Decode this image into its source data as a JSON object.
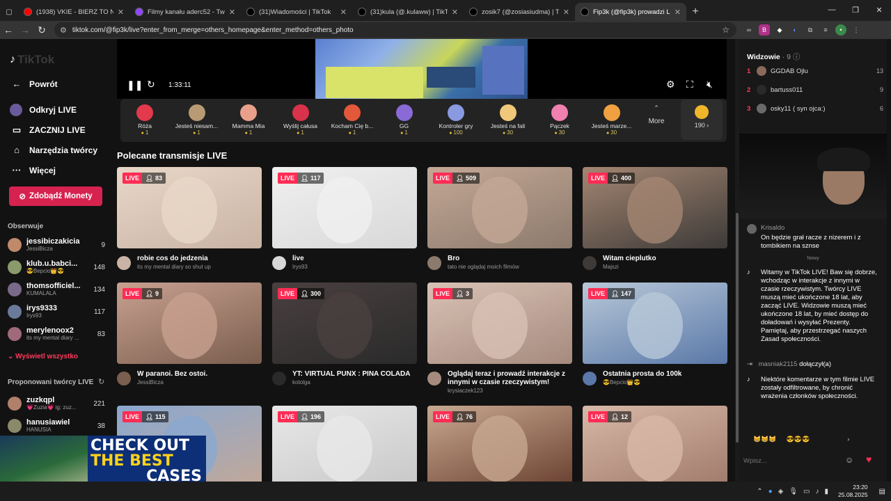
{
  "tabs": [
    {
      "title": "(1938) VKIE - BIERZ TO NA WO",
      "icon": "youtube-icon",
      "color": "#ff0000"
    },
    {
      "title": "Filmy kanału aderc52 - Twitch",
      "icon": "twitch-icon",
      "color": "#9146ff"
    },
    {
      "title": "(31)Wiadomości | TikTok",
      "icon": "tiktok-icon",
      "color": "#000000"
    },
    {
      "title": "(31)kula (@.kulaww) | TikTok",
      "icon": "tiktok-icon",
      "color": "#000000"
    },
    {
      "title": "zosik7 (@zosiasiudma) | TikTok",
      "icon": "tiktok-icon",
      "color": "#000000"
    },
    {
      "title": "Fip3k (@fip3k) prowadzi LIVE",
      "icon": "tiktok-icon",
      "color": "#000000",
      "active": true
    }
  ],
  "address": {
    "url": "tiktok.com/@fip3k/live?enter_from_merge=others_homepage&enter_method=others_photo"
  },
  "sidebar": {
    "logo": "TikTok",
    "nav": [
      {
        "label": "Powrót",
        "icon": "arrow-left-icon"
      },
      {
        "label": "Odkryj LIVE",
        "icon": "live-icon"
      },
      {
        "label": "ZACZNIJ LIVE",
        "icon": "camera-icon"
      },
      {
        "label": "Narzędzia twórcy",
        "icon": "home-icon"
      },
      {
        "label": "Więcej",
        "icon": "more-icon"
      }
    ],
    "coins_button": "Zdobądź Monety",
    "following_title": "Obserwuje",
    "following": [
      {
        "name": "jessibiczakicia",
        "sub": "JessiBicza",
        "count": "9",
        "color": "#c08a6a"
      },
      {
        "name": "klub.u.babci...",
        "sub": "😎Bepcio👑😎",
        "count": "148",
        "color": "#8a9a6a"
      },
      {
        "name": "thomsofficiel...",
        "sub": "KUMALALA",
        "count": "134",
        "color": "#7a6a8a"
      },
      {
        "name": "irys9333",
        "sub": "Irys93",
        "count": "117",
        "color": "#6a7a9a"
      },
      {
        "name": "merylenoox2",
        "sub": "its my mental diary ...",
        "count": "83",
        "color": "#a06a7a"
      }
    ],
    "show_all": "Wyświetl wszystko",
    "suggested_title": "Proponowani twórcy LIVE",
    "suggested": [
      {
        "name": "zuzkqpl",
        "sub": "💗Zuzia💗 ig: zuz...",
        "count": "221",
        "color": "#b0806a"
      },
      {
        "name": "hanusiawiel",
        "sub": "HANUSIA",
        "count": "38",
        "color": "#8a8a6a"
      }
    ]
  },
  "player": {
    "time": "1:33:11"
  },
  "gifts": [
    {
      "name": "Róża",
      "price": "1",
      "color": "#e3394c"
    },
    {
      "name": "Jesteś niesam...",
      "price": "1",
      "color": "#b89a74"
    },
    {
      "name": "Mamma Mia",
      "price": "1",
      "color": "#e9a08a"
    },
    {
      "name": "Wyślij całusa",
      "price": "1",
      "color": "#d8334a"
    },
    {
      "name": "Kocham Cię b...",
      "price": "1",
      "color": "#e3583a"
    },
    {
      "name": "GG",
      "price": "1",
      "color": "#8a6ad6"
    },
    {
      "name": "Kontroler gry",
      "price": "100",
      "color": "#8a9ae0"
    },
    {
      "name": "Jesteś na fali",
      "price": "30",
      "color": "#f0c87a"
    },
    {
      "name": "Pączek",
      "price": "30",
      "color": "#f080b0"
    },
    {
      "name": "Jesteś marze...",
      "price": "30",
      "color": "#f0a040"
    }
  ],
  "gifts_more": "More",
  "coins_balance": "190 ›",
  "recommended_title": "Polecane transmisje LIVE",
  "live_badge": "LIVE",
  "cards": [
    {
      "viewers": "83",
      "title": "robie cos do jedzenia",
      "user": "its my mental diary so shut up",
      "c1": "#c9b3a4",
      "c2": "#e8d7c8"
    },
    {
      "viewers": "117",
      "title": "live",
      "user": "Irys93",
      "c1": "#d8d8d8",
      "c2": "#f0f0f0"
    },
    {
      "viewers": "509",
      "title": "Bro",
      "user": "tato nie oglądaj moich filmów",
      "c1": "#8c7a6c",
      "c2": "#c4a896"
    },
    {
      "viewers": "400",
      "title": "Witam cieplutko",
      "user": "Majszi",
      "c1": "#3d3a38",
      "c2": "#a48672"
    },
    {
      "viewers": "9",
      "title": "W paranoi. Bez ostoi.",
      "user": "JessiBicza",
      "c1": "#7a5e4e",
      "c2": "#c8a090"
    },
    {
      "viewers": "300",
      "title": "YT: VIRTUAL PUNX : PINA COLADA",
      "user": "kotolga",
      "c1": "#2a2a2a",
      "c2": "#4a4040"
    },
    {
      "viewers": "3",
      "title": "Oglądaj teraz i prowadź interakcje z innymi w czasie rzeczywistym!",
      "user": "krysiaczek123",
      "c1": "#a68a7e",
      "c2": "#d8c2b4"
    },
    {
      "viewers": "147",
      "title": "Ostatnia prosta do 100k",
      "user": "😎Bepcio👑😎",
      "c1": "#5a78a8",
      "c2": "#b8c8d8"
    },
    {
      "viewers": "115",
      "title": "",
      "user": "",
      "c1": "#c2a898",
      "c2": "#8aa8d0"
    },
    {
      "viewers": "196",
      "title": "",
      "user": "",
      "c1": "#c8c8c8",
      "c2": "#e8e8e8"
    },
    {
      "viewers": "76",
      "title": "",
      "user": "",
      "c1": "#6a4030",
      "c2": "#c8a890"
    },
    {
      "viewers": "12",
      "title": "",
      "user": "",
      "c1": "#a07a6a",
      "c2": "#d8b8a8"
    }
  ],
  "right": {
    "viewers_title": "Widzowie",
    "viewers_count": "· 9",
    "viewers": [
      {
        "rank": "1",
        "name": "GGDAB Ojlu",
        "score": "13"
      },
      {
        "rank": "2",
        "name": "bartuss011",
        "score": "9"
      },
      {
        "rank": "3",
        "name": "osky11 ( syn ojca:)",
        "score": "6"
      }
    ],
    "chat_user": "Krisaldo",
    "chat_msg": "On będzie grał racze z nizerem i z tombikiem na sznse",
    "new_label": "Nowy",
    "notice1": "Witamy w TikTok LIVE! Baw się dobrze, wchodząc w interakcje z innymi w czasie rzeczywistym. Twórcy LIVE muszą mieć ukończone 18 lat, aby zacząć LIVE. Widzowie muszą mieć ukończone 18 lat, by mieć dostęp do doładowań i wysyłać Prezenty. Pamiętaj, aby przestrzegać naszych Zasad społeczności.",
    "join_user": "masniak2115",
    "join_text": "dołączył(a)",
    "notice2": "Niektóre komentarze w tym filmie LIVE zostały odfiltrowane, by chronić wrażenia członków społeczności.",
    "emoji1": "😸😸😸",
    "emoji2": "😎😎😎",
    "input_placeholder": "Wpisz..."
  },
  "ad": {
    "line1": "CHECK OUT",
    "line2": "THE BEST",
    "line3": "CASES"
  },
  "taskbar": {
    "time": "23:20",
    "date": "25.08.2025"
  }
}
